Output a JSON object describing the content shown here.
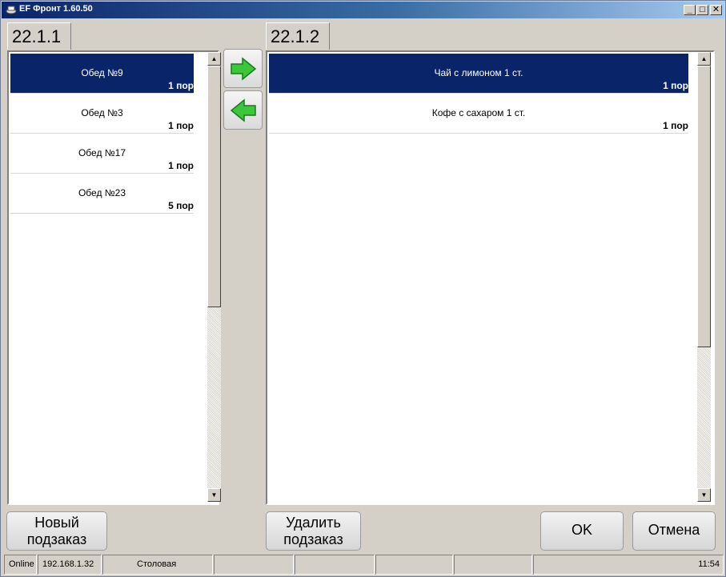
{
  "window": {
    "title": "EF Фронт 1.60.50",
    "controls": {
      "minimize": "_",
      "maximize": "□",
      "close": "✕"
    }
  },
  "left_panel": {
    "tab_label": "22.1.1",
    "items": [
      {
        "name": "Обед №9",
        "qty": "1 пор",
        "selected": true
      },
      {
        "name": "Обед №3",
        "qty": "1 пор",
        "selected": false
      },
      {
        "name": "Обед №17",
        "qty": "1 пор",
        "selected": false
      },
      {
        "name": "Обед №23",
        "qty": "5 пор",
        "selected": false
      }
    ]
  },
  "right_panel": {
    "tab_label": "22.1.2",
    "items": [
      {
        "name": "Чай с лимоном 1 ст.",
        "qty": "1 пор",
        "selected": true
      },
      {
        "name": "Кофе с сахаром 1 ст.",
        "qty": "1 пор",
        "selected": false
      }
    ]
  },
  "transfer": {
    "move_right_icon": "green-arrow-right-icon",
    "move_left_icon": "green-arrow-left-icon",
    "arrow_color": "#3cc63c"
  },
  "buttons": {
    "new_suborder": [
      "Новый",
      "подзаказ"
    ],
    "delete_suborder": [
      "Удалить",
      "подзаказ"
    ],
    "ok": "OK",
    "cancel": "Отмена"
  },
  "status_bar": {
    "connection": "Online",
    "ip": "192.168.1.32",
    "location": "Столовая",
    "time": "11:54"
  },
  "colors": {
    "selection": "#0a246a",
    "window_bg": "#d4d0c8"
  }
}
